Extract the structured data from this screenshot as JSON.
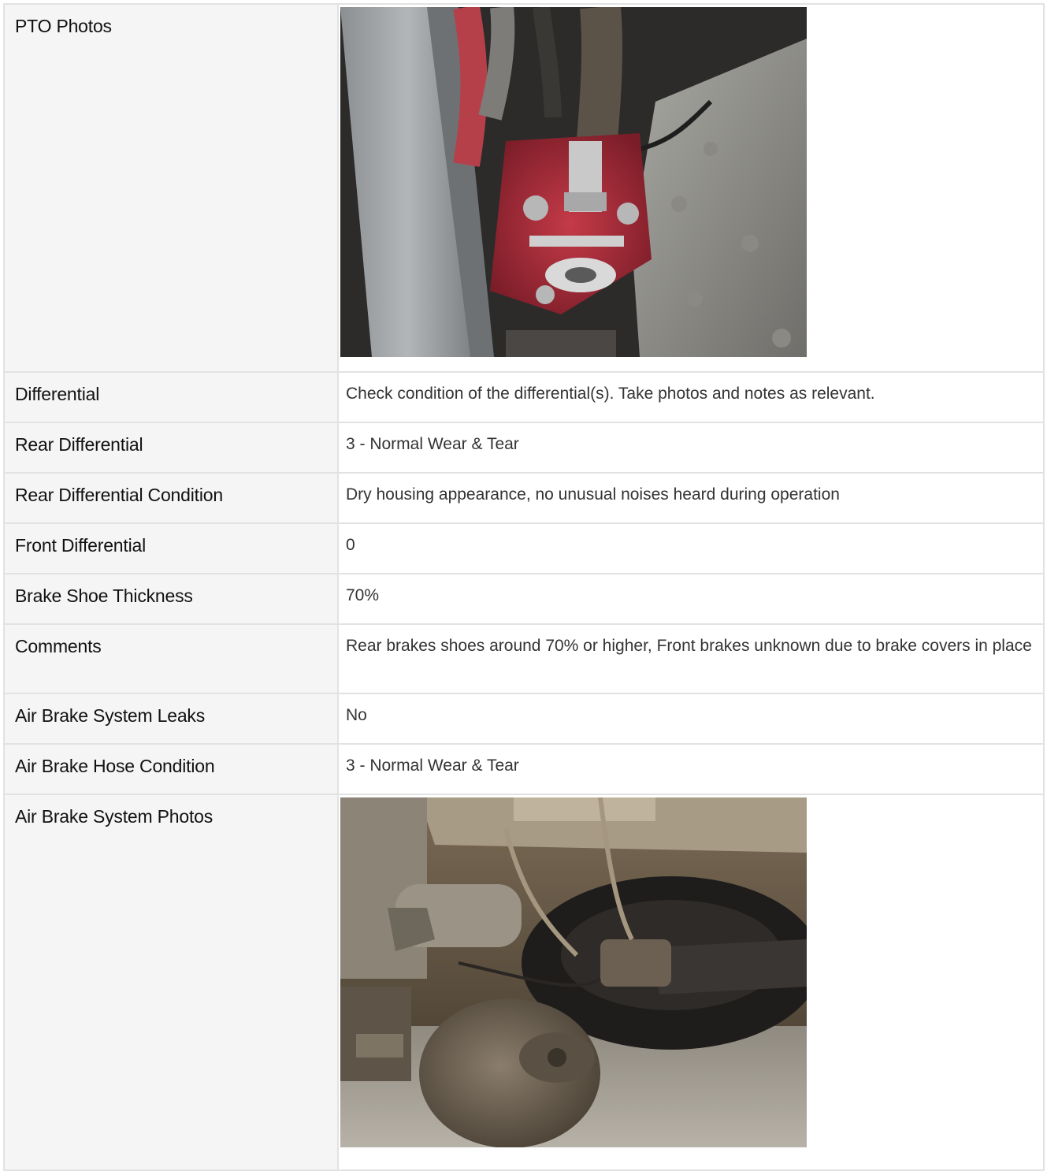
{
  "rows": [
    {
      "label": "PTO Photos",
      "value": "",
      "photo": "pto-photo"
    },
    {
      "label": "Differential",
      "value": "Check condition of the differential(s). Take photos and notes as relevant."
    },
    {
      "label": "Rear Differential",
      "value": "3 - Normal Wear & Tear"
    },
    {
      "label": "Rear Differential Condition",
      "value": "Dry housing appearance, no unusual noises heard during operation"
    },
    {
      "label": "Front Differential",
      "value": "0"
    },
    {
      "label": "Brake Shoe Thickness",
      "value": "70%"
    },
    {
      "label": "Comments",
      "value": "Rear brakes shoes around 70% or higher, Front brakes unknown due to brake covers in place"
    },
    {
      "label": "Air Brake System Leaks",
      "value": "No"
    },
    {
      "label": "Air Brake Hose Condition",
      "value": "3 - Normal Wear & Tear"
    },
    {
      "label": "Air Brake System Photos",
      "value": "",
      "photo": "air-brake-photo"
    }
  ]
}
